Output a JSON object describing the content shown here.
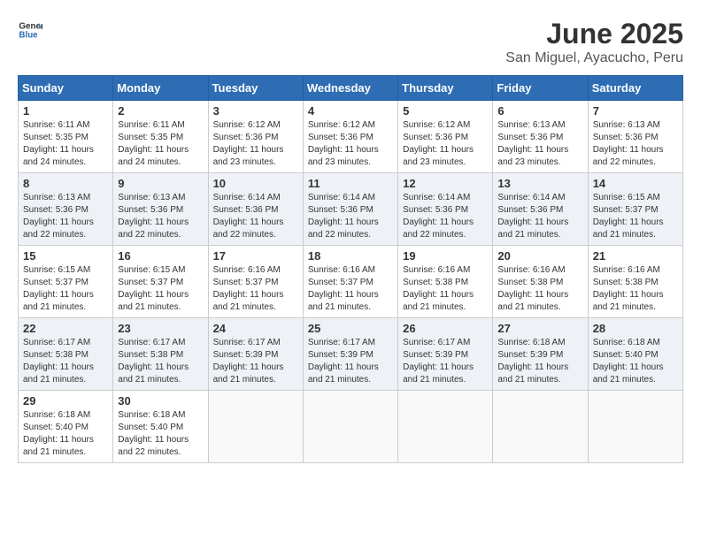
{
  "header": {
    "logo_general": "General",
    "logo_blue": "Blue",
    "title": "June 2025",
    "subtitle": "San Miguel, Ayacucho, Peru"
  },
  "calendar": {
    "days": [
      "Sunday",
      "Monday",
      "Tuesday",
      "Wednesday",
      "Thursday",
      "Friday",
      "Saturday"
    ],
    "weeks": [
      [
        {
          "day": "1",
          "sunrise": "6:11 AM",
          "sunset": "5:35 PM",
          "daylight": "11 hours and 24 minutes."
        },
        {
          "day": "2",
          "sunrise": "6:11 AM",
          "sunset": "5:35 PM",
          "daylight": "11 hours and 24 minutes."
        },
        {
          "day": "3",
          "sunrise": "6:12 AM",
          "sunset": "5:36 PM",
          "daylight": "11 hours and 23 minutes."
        },
        {
          "day": "4",
          "sunrise": "6:12 AM",
          "sunset": "5:36 PM",
          "daylight": "11 hours and 23 minutes."
        },
        {
          "day": "5",
          "sunrise": "6:12 AM",
          "sunset": "5:36 PM",
          "daylight": "11 hours and 23 minutes."
        },
        {
          "day": "6",
          "sunrise": "6:13 AM",
          "sunset": "5:36 PM",
          "daylight": "11 hours and 23 minutes."
        },
        {
          "day": "7",
          "sunrise": "6:13 AM",
          "sunset": "5:36 PM",
          "daylight": "11 hours and 22 minutes."
        }
      ],
      [
        {
          "day": "8",
          "sunrise": "6:13 AM",
          "sunset": "5:36 PM",
          "daylight": "11 hours and 22 minutes."
        },
        {
          "day": "9",
          "sunrise": "6:13 AM",
          "sunset": "5:36 PM",
          "daylight": "11 hours and 22 minutes."
        },
        {
          "day": "10",
          "sunrise": "6:14 AM",
          "sunset": "5:36 PM",
          "daylight": "11 hours and 22 minutes."
        },
        {
          "day": "11",
          "sunrise": "6:14 AM",
          "sunset": "5:36 PM",
          "daylight": "11 hours and 22 minutes."
        },
        {
          "day": "12",
          "sunrise": "6:14 AM",
          "sunset": "5:36 PM",
          "daylight": "11 hours and 22 minutes."
        },
        {
          "day": "13",
          "sunrise": "6:14 AM",
          "sunset": "5:36 PM",
          "daylight": "11 hours and 21 minutes."
        },
        {
          "day": "14",
          "sunrise": "6:15 AM",
          "sunset": "5:37 PM",
          "daylight": "11 hours and 21 minutes."
        }
      ],
      [
        {
          "day": "15",
          "sunrise": "6:15 AM",
          "sunset": "5:37 PM",
          "daylight": "11 hours and 21 minutes."
        },
        {
          "day": "16",
          "sunrise": "6:15 AM",
          "sunset": "5:37 PM",
          "daylight": "11 hours and 21 minutes."
        },
        {
          "day": "17",
          "sunrise": "6:16 AM",
          "sunset": "5:37 PM",
          "daylight": "11 hours and 21 minutes."
        },
        {
          "day": "18",
          "sunrise": "6:16 AM",
          "sunset": "5:37 PM",
          "daylight": "11 hours and 21 minutes."
        },
        {
          "day": "19",
          "sunrise": "6:16 AM",
          "sunset": "5:38 PM",
          "daylight": "11 hours and 21 minutes."
        },
        {
          "day": "20",
          "sunrise": "6:16 AM",
          "sunset": "5:38 PM",
          "daylight": "11 hours and 21 minutes."
        },
        {
          "day": "21",
          "sunrise": "6:16 AM",
          "sunset": "5:38 PM",
          "daylight": "11 hours and 21 minutes."
        }
      ],
      [
        {
          "day": "22",
          "sunrise": "6:17 AM",
          "sunset": "5:38 PM",
          "daylight": "11 hours and 21 minutes."
        },
        {
          "day": "23",
          "sunrise": "6:17 AM",
          "sunset": "5:38 PM",
          "daylight": "11 hours and 21 minutes."
        },
        {
          "day": "24",
          "sunrise": "6:17 AM",
          "sunset": "5:39 PM",
          "daylight": "11 hours and 21 minutes."
        },
        {
          "day": "25",
          "sunrise": "6:17 AM",
          "sunset": "5:39 PM",
          "daylight": "11 hours and 21 minutes."
        },
        {
          "day": "26",
          "sunrise": "6:17 AM",
          "sunset": "5:39 PM",
          "daylight": "11 hours and 21 minutes."
        },
        {
          "day": "27",
          "sunrise": "6:18 AM",
          "sunset": "5:39 PM",
          "daylight": "11 hours and 21 minutes."
        },
        {
          "day": "28",
          "sunrise": "6:18 AM",
          "sunset": "5:40 PM",
          "daylight": "11 hours and 21 minutes."
        }
      ],
      [
        {
          "day": "29",
          "sunrise": "6:18 AM",
          "sunset": "5:40 PM",
          "daylight": "11 hours and 21 minutes."
        },
        {
          "day": "30",
          "sunrise": "6:18 AM",
          "sunset": "5:40 PM",
          "daylight": "11 hours and 22 minutes."
        },
        {
          "day": "",
          "sunrise": "",
          "sunset": "",
          "daylight": ""
        },
        {
          "day": "",
          "sunrise": "",
          "sunset": "",
          "daylight": ""
        },
        {
          "day": "",
          "sunrise": "",
          "sunset": "",
          "daylight": ""
        },
        {
          "day": "",
          "sunrise": "",
          "sunset": "",
          "daylight": ""
        },
        {
          "day": "",
          "sunrise": "",
          "sunset": "",
          "daylight": ""
        }
      ]
    ]
  }
}
